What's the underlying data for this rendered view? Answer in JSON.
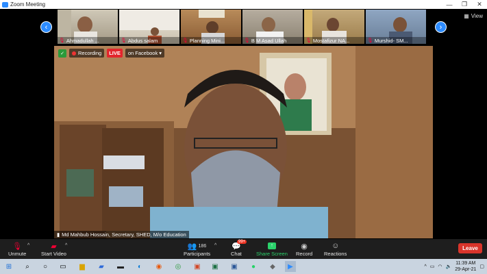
{
  "window": {
    "title": "Zoom Meeting",
    "minimize": "—",
    "maximize": "❐",
    "close": "✕"
  },
  "gallery": {
    "prev": "‹",
    "next": "›",
    "view_label": "View",
    "tiles": [
      {
        "name": "Ahmadullah ..."
      },
      {
        "name": "Abdus salam"
      },
      {
        "name": "Planning Mini..."
      },
      {
        "name": "B M Asad Ullah"
      },
      {
        "name": "Mostafizur NA..."
      },
      {
        "name": "Murshid- SM..."
      }
    ]
  },
  "main_video": {
    "recording_label": "Recording",
    "live_label": "LIVE",
    "live_target": "on Facebook ▾",
    "speaker_name": "Md Mahbub Hossain, Secretary, SHED, M/o Education"
  },
  "controls": {
    "unmute": "Unmute",
    "start_video": "Start Video",
    "participants": "Participants",
    "participants_count": "186",
    "chat": "Chat",
    "chat_badge": "99+",
    "share_screen": "Share Screen",
    "record": "Record",
    "reactions": "Reactions",
    "leave": "Leave",
    "share_color": "#2bd26b"
  },
  "taskbar": {
    "time": "11:39 AM",
    "date": "29-Apr-21"
  }
}
